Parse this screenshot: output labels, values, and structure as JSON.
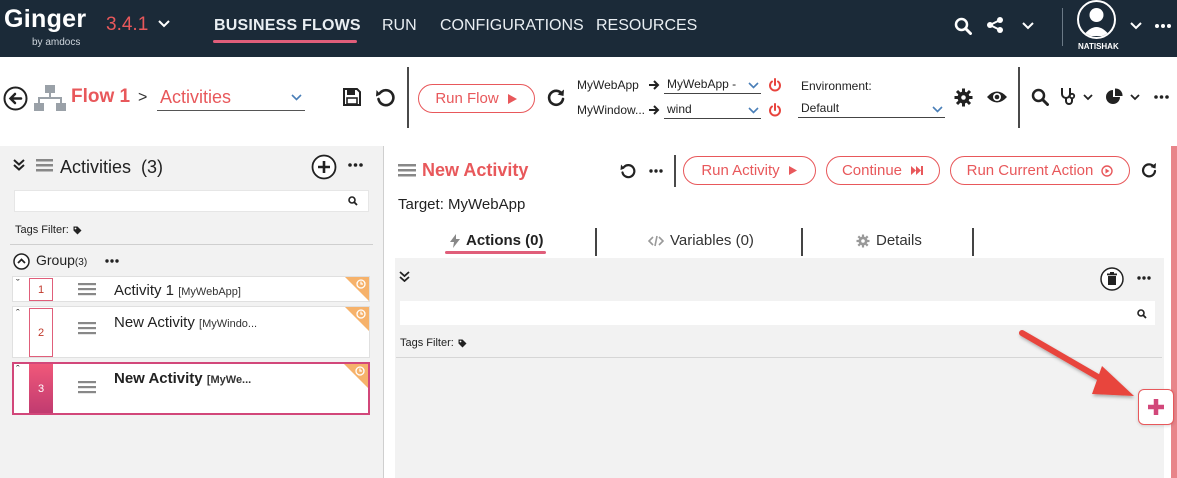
{
  "app": {
    "name": "Ginger",
    "byline": "by amdocs",
    "version": "3.4.1"
  },
  "nav": {
    "tabs": [
      {
        "label": "BUSINESS FLOWS",
        "active": true
      },
      {
        "label": "RUN"
      },
      {
        "label": "CONFIGURATIONS"
      },
      {
        "label": "RESOURCES"
      }
    ],
    "user": "NATISHAK"
  },
  "toolbar": {
    "flow_title": "Flow 1",
    "breadcrumb_sep": ">",
    "view_select": "Activities",
    "run_flow_label": "Run Flow",
    "app_map": [
      {
        "app": "MyWebApp",
        "agent": "MyWebApp -"
      },
      {
        "app": "MyWindow...",
        "agent": "wind"
      }
    ],
    "environment_label": "Environment:",
    "environment_value": "Default"
  },
  "left": {
    "title": "Activities",
    "count": "(3)",
    "tags_filter_label": "Tags Filter:",
    "group": {
      "label": "Group",
      "count": "(3)"
    },
    "activities": [
      {
        "num": "1",
        "name": "Activity 1",
        "tag": "[MyWebApp]",
        "selected": false
      },
      {
        "num": "2",
        "name": "New Activity",
        "tag": "[MyWindo...",
        "selected": false
      },
      {
        "num": "3",
        "name": "New Activity",
        "tag": "[MyWe...",
        "selected": true
      }
    ]
  },
  "main": {
    "activity_title": "New Activity",
    "run_activity_label": "Run Activity",
    "continue_label": "Continue",
    "run_current_label": "Run Current Action",
    "target_label": "Target: MyWebApp",
    "tabs": [
      {
        "label": "Actions (0)",
        "active": true
      },
      {
        "label": "Variables (0)"
      },
      {
        "label": "Details"
      }
    ],
    "tags_filter_label": "Tags Filter:"
  },
  "colors": {
    "accent": "#e8585b",
    "accent_pink": "#e05e7a",
    "nav_bg": "#1b2a38",
    "badge": "#f6b26b",
    "arrow": "#e8443d"
  }
}
